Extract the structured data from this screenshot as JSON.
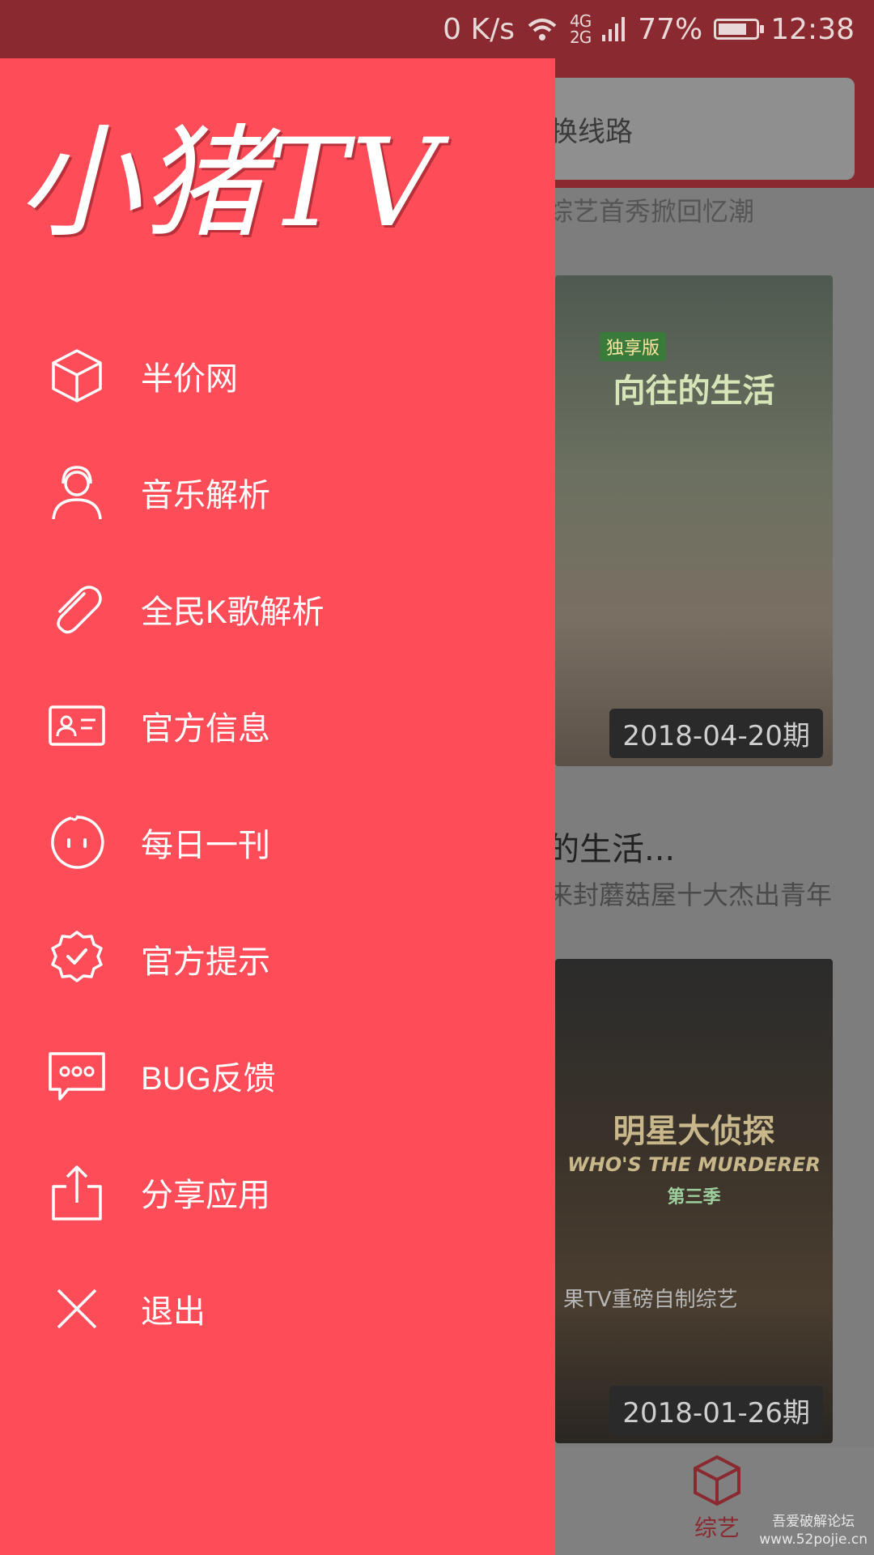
{
  "status_bar": {
    "net_speed": "0 K/s",
    "network_label": "4G\n2G",
    "battery": "77%",
    "battery_level": 0.77,
    "time": "12:38"
  },
  "background": {
    "search_placeholder": "换线路",
    "top_caption": "综艺首秀掀回忆潮",
    "card1": {
      "title": "向往的生活",
      "badge": "独享版",
      "date": "2018-04-20期",
      "name": "的生活...",
      "desc": "来封蘑菇屋十大杰出青年"
    },
    "card2": {
      "title": "明星大侦探",
      "subtitle": "WHO'S THE MURDERER",
      "season": "第三季",
      "tagline": "果TV重磅自制综艺",
      "date": "2018-01-26期"
    },
    "bottom_nav": {
      "label": "综艺",
      "icon": "box-icon",
      "active_color": "#fe4d58"
    },
    "watermark": {
      "line1": "吾爱破解论坛",
      "line2": "www.52pojie.cn"
    }
  },
  "drawer": {
    "logo_text": "小猪TV",
    "background_color": "#fe4d58",
    "items": [
      {
        "label": "半价网",
        "icon": "box-icon"
      },
      {
        "label": "音乐解析",
        "icon": "headset-user-icon"
      },
      {
        "label": "全民K歌解析",
        "icon": "paperclip-icon"
      },
      {
        "label": "官方信息",
        "icon": "id-card-icon"
      },
      {
        "label": "每日一刊",
        "icon": "face-icon"
      },
      {
        "label": "官方提示",
        "icon": "verified-badge-icon"
      },
      {
        "label": "BUG反馈",
        "icon": "chat-bubble-icon"
      },
      {
        "label": "分享应用",
        "icon": "share-icon"
      },
      {
        "label": "退出",
        "icon": "close-icon"
      }
    ]
  }
}
